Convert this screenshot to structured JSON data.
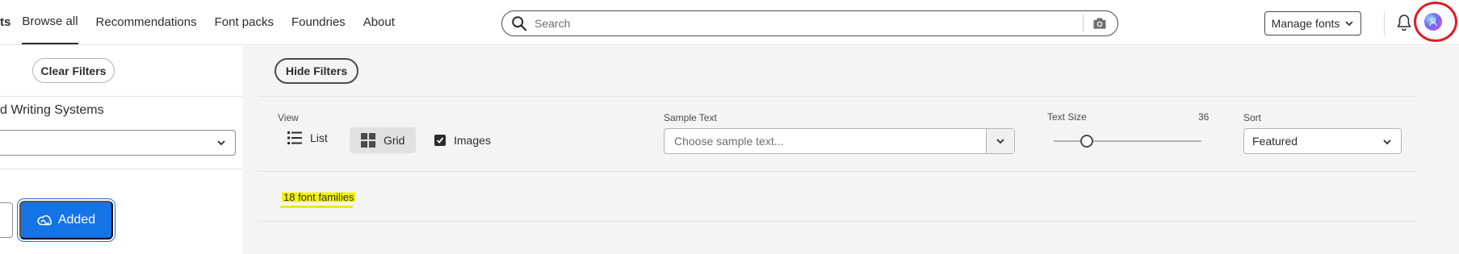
{
  "nav": {
    "items": [
      {
        "label": "ts",
        "active": false
      },
      {
        "label": "Browse all",
        "active": true
      },
      {
        "label": "Recommendations",
        "active": false
      },
      {
        "label": "Font packs",
        "active": false
      },
      {
        "label": "Foundries",
        "active": false
      },
      {
        "label": "About",
        "active": false
      }
    ]
  },
  "search": {
    "placeholder": "Search",
    "icon": "search-icon",
    "camera_icon": "camera-icon"
  },
  "header": {
    "manage_fonts_label": "Manage fonts",
    "bell_icon": "bell-icon",
    "avatar_icon": "avatar"
  },
  "sidebar": {
    "clear_filters_label": "Clear Filters",
    "language_label": "d Writing Systems",
    "language_value": "",
    "added_label": "Added"
  },
  "main": {
    "hide_filters_label": "Hide Filters",
    "view_label": "View",
    "list_label": "List",
    "grid_label": "Grid",
    "images_label": "Images",
    "images_checked": true,
    "sample_text_label": "Sample Text",
    "sample_text_placeholder": "Choose sample text...",
    "text_size_label": "Text Size",
    "text_size_value": "36",
    "sort_label": "Sort",
    "sort_value": "Featured",
    "result_count": "18 font families"
  },
  "colors": {
    "accent": "#1473e6",
    "highlight": "#f4f30a",
    "annotation_circle": "#e01b24",
    "panel_bg": "#f4f4f4"
  }
}
